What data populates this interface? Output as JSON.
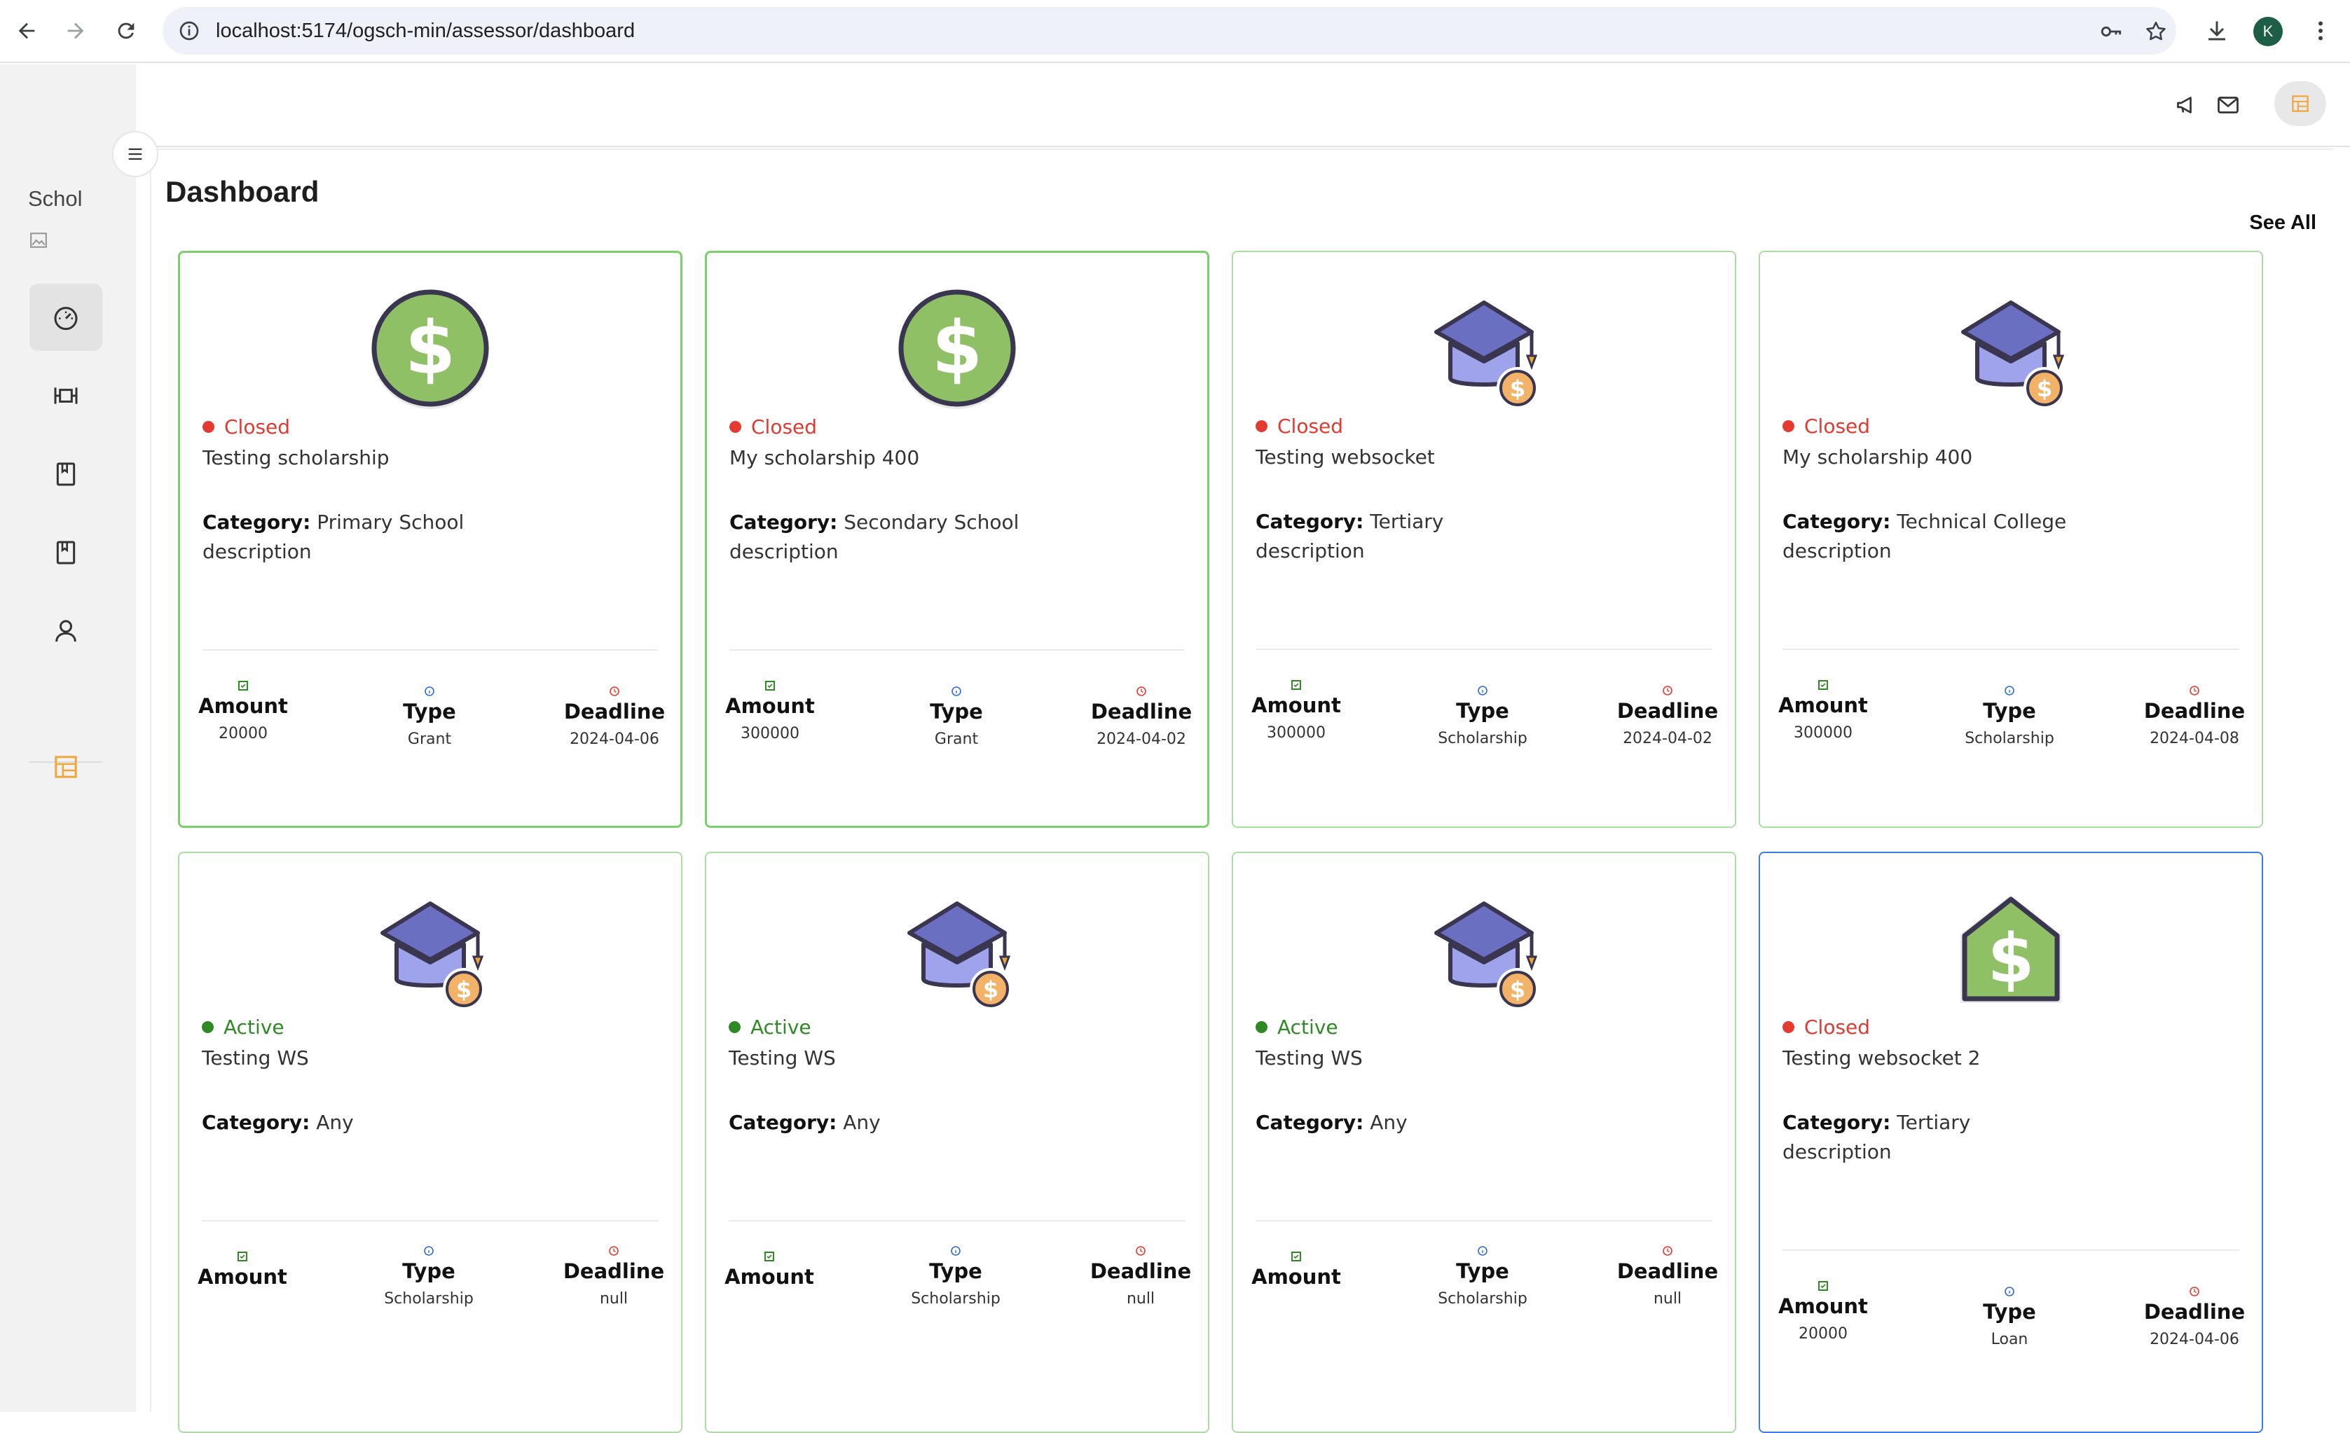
{
  "browser": {
    "url": "localhost:5174/ogsch-min/assessor/dashboard",
    "profile_initial": "K"
  },
  "sidebar": {
    "logo_alt": "Schol",
    "items": [
      {
        "icon": "dashboard-gauge-icon",
        "active": true
      },
      {
        "icon": "columns-icon",
        "active": false
      },
      {
        "icon": "bookmark-icon",
        "active": false
      },
      {
        "icon": "bookmark-icon",
        "active": false
      },
      {
        "icon": "user-icon",
        "active": false
      },
      {
        "icon": "layout-icon",
        "active": false,
        "color": "#f0a63a"
      }
    ]
  },
  "header": {
    "icons": [
      "megaphone-icon",
      "mail-icon",
      "layout-icon"
    ]
  },
  "page": {
    "title": "Dashboard",
    "see_all": "See All"
  },
  "labels": {
    "category": "Category:",
    "amount": "Amount",
    "type": "Type",
    "deadline": "Deadline"
  },
  "colors": {
    "closed": "#e53a2f",
    "active": "#2f8a24",
    "card_border": "#7ccf6d",
    "highlight_border": "#3d7be8"
  },
  "cards": [
    {
      "icon": "dollar-coin-icon",
      "status": "Closed",
      "title": "Testing scholarship",
      "category": "Primary School",
      "description": "description",
      "amount": "20000",
      "type": "Grant",
      "deadline": "2024-04-06"
    },
    {
      "icon": "dollar-coin-icon",
      "status": "Closed",
      "title": "My scholarship 400",
      "category": "Secondary School",
      "description": "description",
      "amount": "300000",
      "type": "Grant",
      "deadline": "2024-04-02"
    },
    {
      "icon": "graduation-cap-icon",
      "status": "Closed",
      "title": "Testing websocket",
      "category": "Tertiary",
      "description": "description",
      "amount": "300000",
      "type": "Scholarship",
      "deadline": "2024-04-02"
    },
    {
      "icon": "graduation-cap-icon",
      "status": "Closed",
      "title": "My scholarship 400",
      "category": "Technical College",
      "description": "description",
      "amount": "300000",
      "type": "Scholarship",
      "deadline": "2024-04-08"
    },
    {
      "icon": "graduation-cap-icon",
      "status": "Active",
      "title": "Testing WS",
      "category": "Any",
      "description": "",
      "amount": "",
      "type": "Scholarship",
      "deadline": "null"
    },
    {
      "icon": "graduation-cap-icon",
      "status": "Active",
      "title": "Testing WS",
      "category": "Any",
      "description": "",
      "amount": "",
      "type": "Scholarship",
      "deadline": "null"
    },
    {
      "icon": "graduation-cap-icon",
      "status": "Active",
      "title": "Testing WS",
      "category": "Any",
      "description": "",
      "amount": "",
      "type": "Scholarship",
      "deadline": "null"
    },
    {
      "icon": "dollar-house-icon",
      "status": "Closed",
      "title": "Testing websocket 2",
      "category": "Tertiary",
      "description": "description",
      "amount": "20000",
      "type": "Loan",
      "deadline": "2024-04-06"
    }
  ]
}
